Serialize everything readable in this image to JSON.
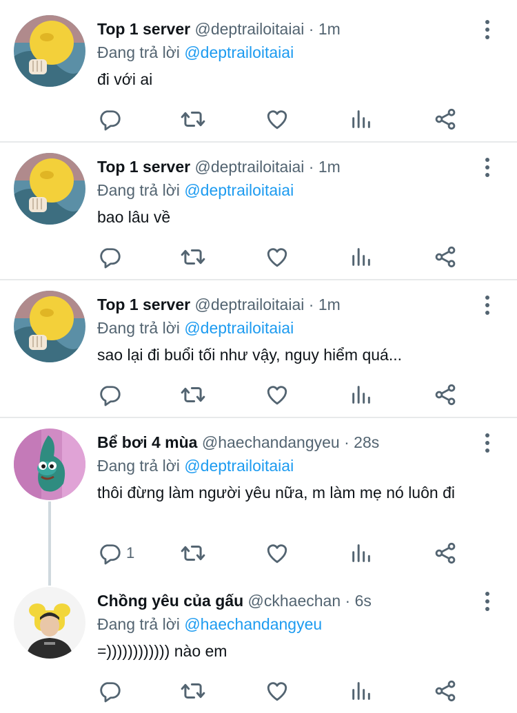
{
  "tweets": [
    {
      "name": "Top 1 server",
      "handle": "@deptrailoitaiai",
      "time": "1m",
      "reply_prefix": "Đang trả lời",
      "reply_to": "@deptrailoitaiai",
      "text": "đi với ai",
      "reply_count": ""
    },
    {
      "name": "Top 1 server",
      "handle": "@deptrailoitaiai",
      "time": "1m",
      "reply_prefix": "Đang trả lời",
      "reply_to": "@deptrailoitaiai",
      "text": "bao lâu về",
      "reply_count": ""
    },
    {
      "name": "Top 1 server",
      "handle": "@deptrailoitaiai",
      "time": "1m",
      "reply_prefix": "Đang trả lời",
      "reply_to": "@deptrailoitaiai",
      "text": "sao lại đi buổi tối như vậy, nguy hiểm quá...",
      "reply_count": ""
    },
    {
      "name": "Bể bơi 4 mùa",
      "handle": "@haechandangyeu",
      "time": "28s",
      "reply_prefix": "Đang trả lời",
      "reply_to": "@deptrailoitaiai",
      "text": "thôi đừng làm người yêu nữa, m làm mẹ nó luôn đi",
      "reply_count": "1"
    },
    {
      "name": "Chồng yêu của gấu",
      "handle": "@ckhaechan",
      "time": "6s",
      "reply_prefix": "Đang trả lời",
      "reply_to": "@haechandangyeu",
      "text": "=)))))))))))) nào em",
      "reply_count": ""
    }
  ],
  "separator": "·",
  "colors": {
    "text": "#0f1419",
    "secondary": "#536471",
    "link": "#1d9bf0",
    "divider": "#e7e9ea"
  },
  "icons": [
    "reply-icon",
    "retweet-icon",
    "like-icon",
    "views-icon",
    "share-icon",
    "more-icon"
  ]
}
